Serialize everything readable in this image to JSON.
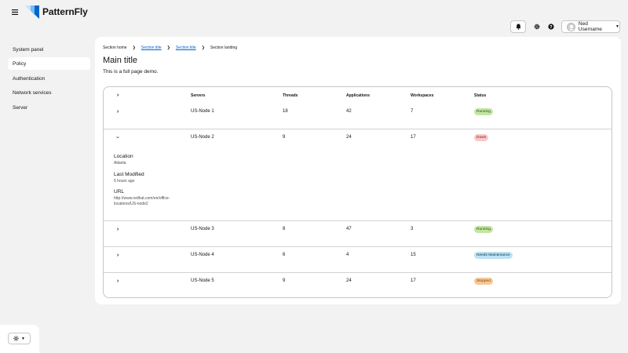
{
  "header": {
    "brand": "PatternFly",
    "user_name": "Ned Username"
  },
  "sidebar": {
    "items": [
      {
        "label": "System panel"
      },
      {
        "label": "Policy"
      },
      {
        "label": "Authentication"
      },
      {
        "label": "Network services"
      },
      {
        "label": "Server"
      }
    ],
    "active": "Policy"
  },
  "breadcrumb": {
    "items": [
      "Section home",
      "Section title",
      "Section title",
      "Section landing"
    ]
  },
  "page": {
    "title": "Main title",
    "subtitle": "This is a full page demo."
  },
  "table": {
    "columns": [
      "Servers",
      "Threads",
      "Applications",
      "Workspaces",
      "Status"
    ],
    "rows": [
      {
        "server": "US-Node 1",
        "threads": "18",
        "applications": "42",
        "workspaces": "7",
        "status": "Running"
      },
      {
        "server": "US-Node 2",
        "threads": "9",
        "applications": "24",
        "workspaces": "17",
        "status": "Down"
      },
      {
        "server": "US-Node 3",
        "threads": "8",
        "applications": "47",
        "workspaces": "3",
        "status": "Running"
      },
      {
        "server": "US-Node 4",
        "threads": "6",
        "applications": "4",
        "workspaces": "15",
        "status": "Needs Maintenance"
      },
      {
        "server": "US-Node 5",
        "threads": "9",
        "applications": "24",
        "workspaces": "17",
        "status": "Stopped"
      }
    ],
    "expanded": {
      "location_label": "Location",
      "location_value": "Atlanta",
      "modified_label": "Last Modified",
      "modified_value": "5 hours ago",
      "url_label": "URL",
      "url_value": "http://www.redhat.com/en/office-locations/US-node2"
    }
  },
  "icons": {
    "menu": "hamburger-icon",
    "notifications": "bell-icon",
    "settings": "gear-icon",
    "help": "help-icon",
    "theme": "sun-icon"
  },
  "colors": {
    "running": "#c5e5a3",
    "down": "#f9c8c8",
    "maintenance": "#bee1f4",
    "stopped": "#f8c896",
    "link": "#0066cc"
  }
}
